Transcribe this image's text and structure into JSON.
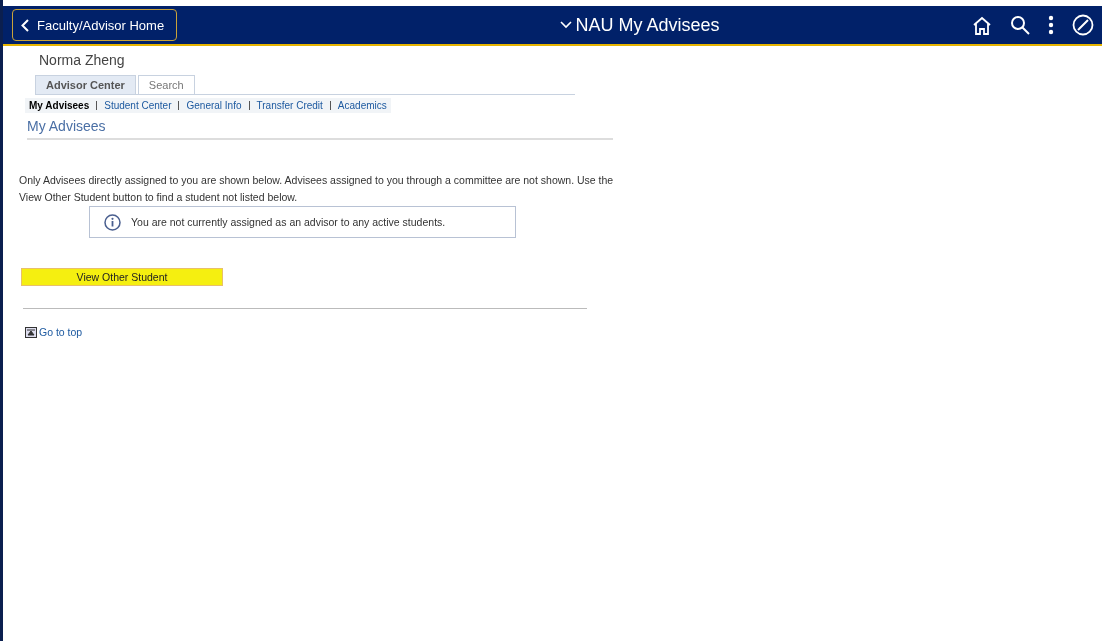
{
  "header": {
    "back_button": "Faculty/Advisor Home",
    "title": "NAU My Advisees"
  },
  "user_name": "Norma Zheng",
  "tabs": [
    {
      "label": "Advisor Center",
      "selected": true
    },
    {
      "label": "Search",
      "selected": false
    }
  ],
  "subtabs": [
    {
      "label": "My Advisees",
      "selected": true
    },
    {
      "label": "Student Center",
      "selected": false
    },
    {
      "label": "General Info",
      "selected": false
    },
    {
      "label": "Transfer Credit",
      "selected": false
    },
    {
      "label": "Academics",
      "selected": false
    }
  ],
  "section_title": "My Advisees",
  "instructions": "Only Advisees directly assigned to you are shown below. Advisees assigned to you through a committee are not shown. Use the View Other Student button to find a student not listed below.",
  "notice": "You are not currently assigned as an advisor to any active students.",
  "view_button": {
    "label": "View Other Student",
    "highlighted": true
  },
  "go_to_top": "Go to top"
}
